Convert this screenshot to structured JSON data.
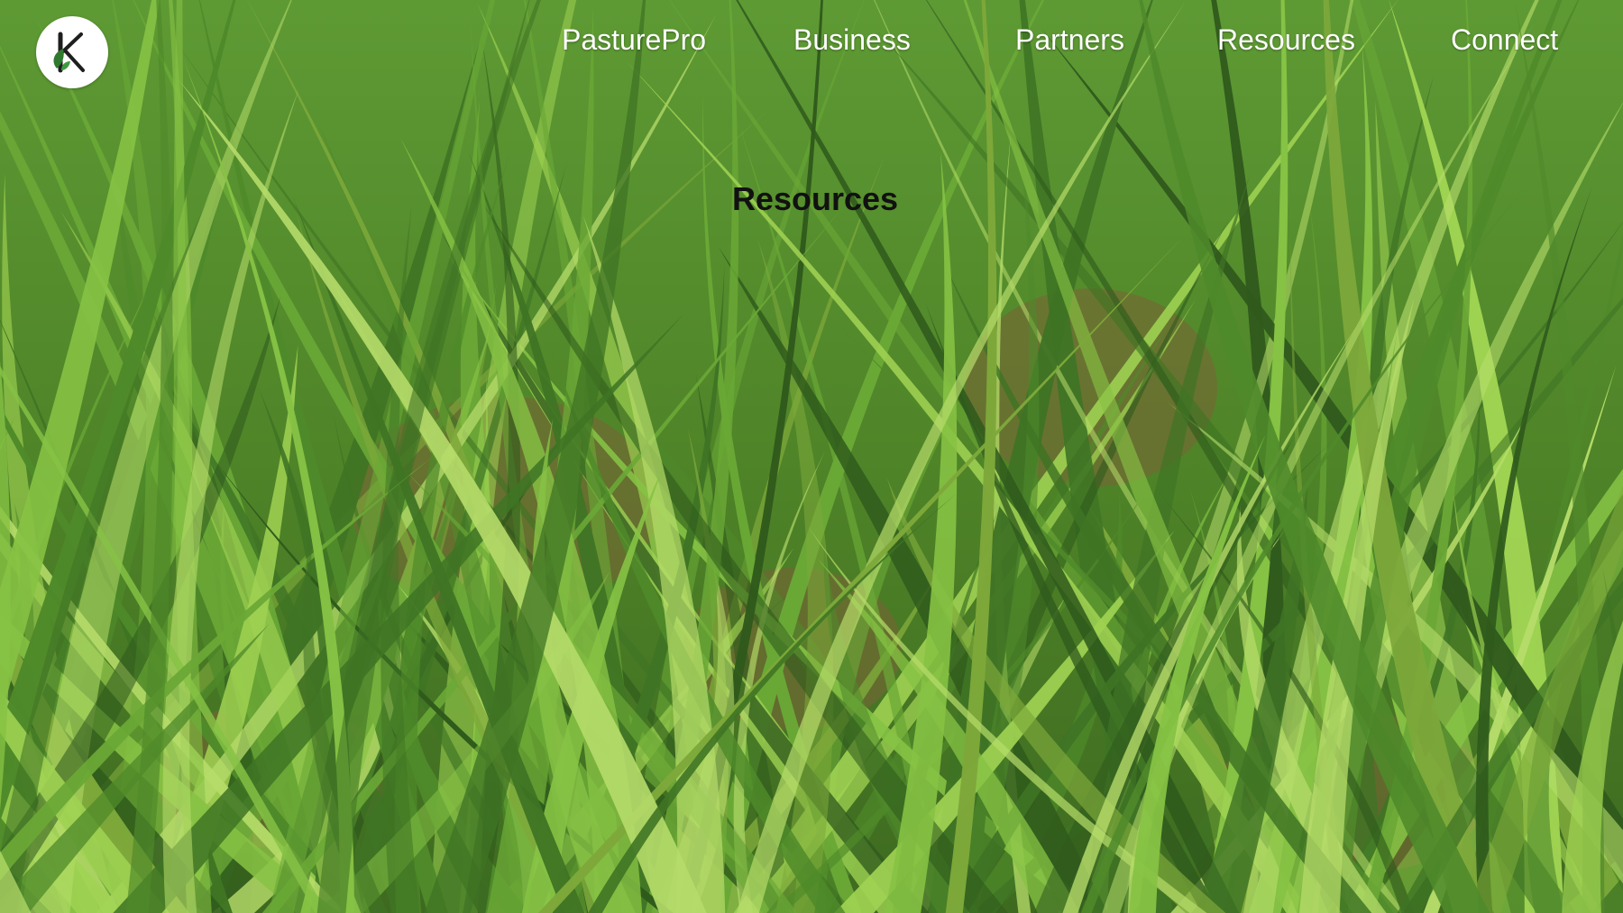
{
  "logo": {
    "icon": "k-leaf-logo-icon",
    "background": "#ffffff",
    "letter_color": "#1e1e1e",
    "leaf_color": "#2f7a2f"
  },
  "nav": {
    "items": [
      {
        "label": "PasturePro"
      },
      {
        "label": "Business"
      },
      {
        "label": "Partners"
      },
      {
        "label": "Resources"
      },
      {
        "label": "Connect"
      }
    ],
    "color": "#ffffff"
  },
  "main": {
    "section_title": "Resources",
    "title_color": "#111111"
  },
  "background": {
    "image": "grass-field-photo",
    "colors": {
      "deep": "#2f5a1c",
      "mid": "#5f8f2e",
      "light": "#9fcf4f",
      "dry": "#8a6a3a"
    }
  }
}
